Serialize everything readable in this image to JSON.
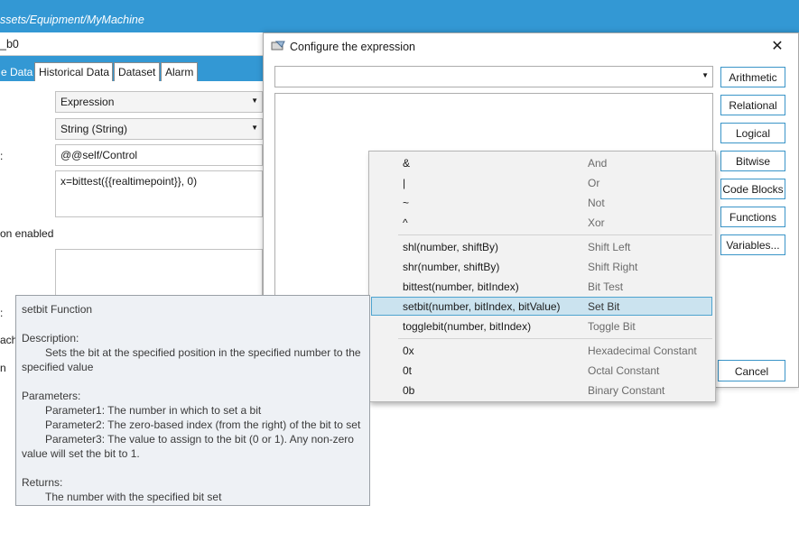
{
  "app": {
    "path": "ssets/Equipment/MyMachine",
    "name_value": "_b0",
    "tabs": [
      {
        "label": "e Data",
        "active": true
      },
      {
        "label": "Historical Data",
        "active": false
      },
      {
        "label": "Dataset",
        "active": false
      },
      {
        "label": "Alarm",
        "active": false
      }
    ],
    "form": {
      "type_select": "Expression",
      "datatype_select": "String (String)",
      "tag_field": "@@self/Control",
      "expression_field": "x=bittest({{realtimepoint}}, 0)",
      "label_colon": ":",
      "label_enabled": "on enabled",
      "label_colon2": ":",
      "label_each": "ach",
      "label_n": "n"
    }
  },
  "dialog": {
    "title": "Configure the expression",
    "close_glyph": "✕",
    "expression_combo_value": "",
    "buttons": {
      "arithmetic": "Arithmetic",
      "relational": "Relational",
      "logical": "Logical",
      "bitwise": "Bitwise",
      "code_blocks": "Code Blocks",
      "functions": "Functions",
      "variables": "Variables...",
      "cancel": "Cancel"
    }
  },
  "menu": {
    "groups": [
      [
        {
          "label": "&",
          "desc": "And"
        },
        {
          "label": "|",
          "desc": "Or"
        },
        {
          "label": "~",
          "desc": "Not"
        },
        {
          "label": "^",
          "desc": "Xor"
        }
      ],
      [
        {
          "label": "shl(number, shiftBy)",
          "desc": "Shift Left"
        },
        {
          "label": "shr(number, shiftBy)",
          "desc": "Shift Right"
        },
        {
          "label": "bittest(number, bitIndex)",
          "desc": "Bit Test"
        },
        {
          "label": "setbit(number, bitIndex, bitValue)",
          "desc": "Set Bit"
        },
        {
          "label": "togglebit(number, bitIndex)",
          "desc": "Toggle Bit"
        }
      ],
      [
        {
          "label": "0x",
          "desc": "Hexadecimal Constant"
        },
        {
          "label": "0t",
          "desc": "Octal Constant"
        },
        {
          "label": "0b",
          "desc": "Binary Constant"
        }
      ]
    ],
    "highlighted": "setbit(number, bitIndex, bitValue)"
  },
  "tooltip": {
    "title": "setbit Function",
    "description_heading": "Description:",
    "description_line1": "Sets the bit at the specified position in the specified number to the",
    "description_line2": "specified value",
    "parameters_heading": "Parameters:",
    "param1": "Parameter1: The number in which to set a bit",
    "param2": "Parameter2: The zero-based index (from the right) of the bit to set",
    "param3_line1": "Parameter3: The value to assign to the bit (0 or 1).  Any non-zero",
    "param3_line2": "value will set the bit to 1.",
    "returns_heading": "Returns:",
    "returns_text": "The number with the specified bit set"
  },
  "colors": {
    "accent": "#3398d4",
    "button_border": "#3a95c8",
    "menu_highlight": "#cbe3ef",
    "tooltip_bg": "#eef1f5"
  }
}
